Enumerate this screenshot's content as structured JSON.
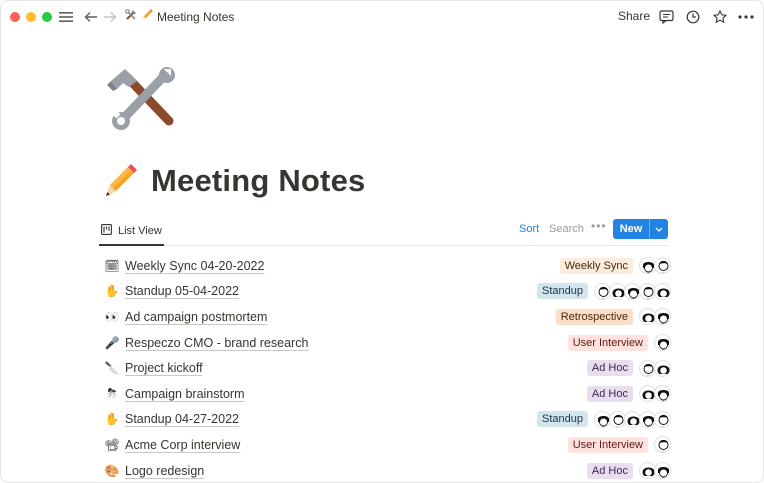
{
  "window": {
    "traffic_colors": [
      "#ff5f57",
      "#febc2e",
      "#28c840"
    ]
  },
  "topbar": {
    "icons": [
      "menu-icon",
      "arrow-left-icon",
      "arrow-right-icon"
    ],
    "breadcrumb_icons": [
      "hammer-wrench-emoji",
      "pencil-emoji"
    ],
    "breadcrumb_label": "Meeting Notes",
    "share_label": "Share",
    "right_icons": [
      "comment-icon",
      "clock-icon",
      "star-icon",
      "more-icon"
    ]
  },
  "page": {
    "icon": "hammer-and-wrench-emoji",
    "title_emoji": "pencil-emoji",
    "title": "Meeting Notes"
  },
  "view": {
    "tab_label": "List View",
    "tab_icon": "list-view-icon",
    "sort_label": "Sort",
    "search_label": "Search",
    "more_label": "•••",
    "new_label": "New",
    "accent": "#2383e2"
  },
  "tag_styles": {
    "Weekly Sync": {
      "bg": "#fbecdd",
      "fg": "#49290e"
    },
    "Standup": {
      "bg": "#d3e5ef",
      "fg": "#183347"
    },
    "Retrospective": {
      "bg": "#fadec9",
      "fg": "#49290e"
    },
    "User Interview": {
      "bg": "#ffe2dd",
      "fg": "#5d1715"
    },
    "Ad Hoc": {
      "bg": "#e8deee",
      "fg": "#412454"
    }
  },
  "rows": [
    {
      "icon": "🗓",
      "title": "Weekly Sync 04-20-2022",
      "tag": "Weekly Sync",
      "avatars": 2
    },
    {
      "icon": "✋",
      "title": "Standup 05-04-2022",
      "tag": "Standup",
      "avatars": 5
    },
    {
      "icon": "👀",
      "title": "Ad campaign postmortem",
      "tag": "Retrospective",
      "avatars": 2
    },
    {
      "icon": "🎤",
      "title": "Respeczo CMO - brand research",
      "tag": "User Interview",
      "avatars": 1
    },
    {
      "icon": "🔪",
      "title": "Project kickoff",
      "tag": "Ad Hoc",
      "avatars": 2
    },
    {
      "icon": "⛈",
      "title": "Campaign brainstorm",
      "tag": "Ad Hoc",
      "avatars": 2
    },
    {
      "icon": "✋",
      "title": "Standup 04-27-2022",
      "tag": "Standup",
      "avatars": 5
    },
    {
      "icon": "📽",
      "title": "Acme Corp interview",
      "tag": "User Interview",
      "avatars": 1
    },
    {
      "icon": "🎨",
      "title": "Logo redesign",
      "tag": "Ad Hoc",
      "avatars": 2
    }
  ]
}
